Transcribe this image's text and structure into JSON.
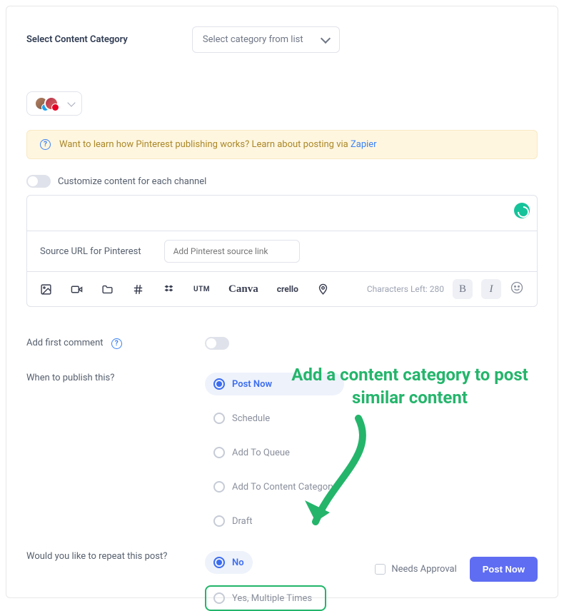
{
  "category": {
    "label": "Select Content Category",
    "placeholder": "Select category from list"
  },
  "info_banner": {
    "text_prefix": "Want to learn how Pinterest publishing works? Learn about posting via ",
    "link": "Zapier"
  },
  "customize_toggle": {
    "label": "Customize content for each channel"
  },
  "source": {
    "label": "Source URL for Pinterest",
    "placeholder": "Add Pinterest source link"
  },
  "chars": {
    "label": "Characters Left:",
    "value": "280"
  },
  "toolbar": {
    "utm": "UTM",
    "canva": "Canva",
    "crello": "crello"
  },
  "first_comment": {
    "label": "Add first comment"
  },
  "publish": {
    "label": "When to publish this?",
    "options": {
      "now": "Post Now",
      "schedule": "Schedule",
      "queue": "Add To Queue",
      "content_cat": "Add To Content Category",
      "draft": "Draft"
    }
  },
  "repeat": {
    "label": "Would you like to repeat this post?",
    "no": "No",
    "yes": "Yes, Multiple Times"
  },
  "footer": {
    "approval": "Needs Approval",
    "post_btn": "Post Now"
  },
  "annotation": "Add a content category to post similar content"
}
